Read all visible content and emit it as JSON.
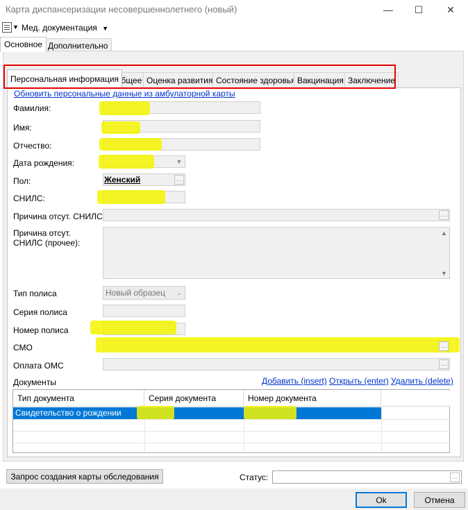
{
  "window": {
    "title": "Карта диспансеризации несовершеннолетнего (новый)",
    "minimize_glyph": "—",
    "maximize_glyph": "☐",
    "close_glyph": "✕"
  },
  "toolbar": {
    "doc_icon": "document-icon",
    "menu_label": "Мед. документация"
  },
  "outer_tabs": [
    {
      "label": "Основное",
      "active": true
    },
    {
      "label": "Дополнительно",
      "active": false
    }
  ],
  "inner_tabs": [
    {
      "label": "Персональная информация",
      "active": true
    },
    {
      "label": "Общее"
    },
    {
      "label": "Оценка развития"
    },
    {
      "label": "Состояние здоровья"
    },
    {
      "label": "Вакцинация"
    },
    {
      "label": "Заключение"
    }
  ],
  "form": {
    "refresh_link": "Обновить персональные данные из амбулаторной карты",
    "surname_label": "Фамилия:",
    "name_label": "Имя:",
    "patronymic_label": "Отчество:",
    "birthdate_label": "Дата рождения:",
    "sex_label": "Пол:",
    "sex_value": "Женский",
    "snils_label": "СНИЛС:",
    "snils_absent_label": "Причина отсут. СНИЛС:",
    "snils_other_label": "Причина отсут. СНИЛС (прочее):",
    "policy_type_label": "Тип полиса",
    "policy_type_value": "Новый образец",
    "policy_series_label": "Серия полиса",
    "policy_number_label": "Номер полиса",
    "smo_label": "СМО",
    "oms_label": "Оплата ОМС"
  },
  "documents": {
    "label": "Документы",
    "add_link": "Добавить (insert)",
    "open_link": "Открыть (enter)",
    "delete_link": "Удалить (delete)",
    "columns": [
      "Тип документа",
      "Серия документа",
      "Номер документа"
    ],
    "rows": [
      {
        "type": "Свидетельство о рождении",
        "series": "",
        "number": ""
      }
    ]
  },
  "footer": {
    "request_button": "Запрос создания карты обследования",
    "status_label": "Статус:",
    "ok_button": "Ok",
    "cancel_button": "Отмена"
  },
  "colors": {
    "highlight": "#f5f500",
    "selection": "#0078d7",
    "tab_outline": "#e60000",
    "link": "#0033cc"
  }
}
